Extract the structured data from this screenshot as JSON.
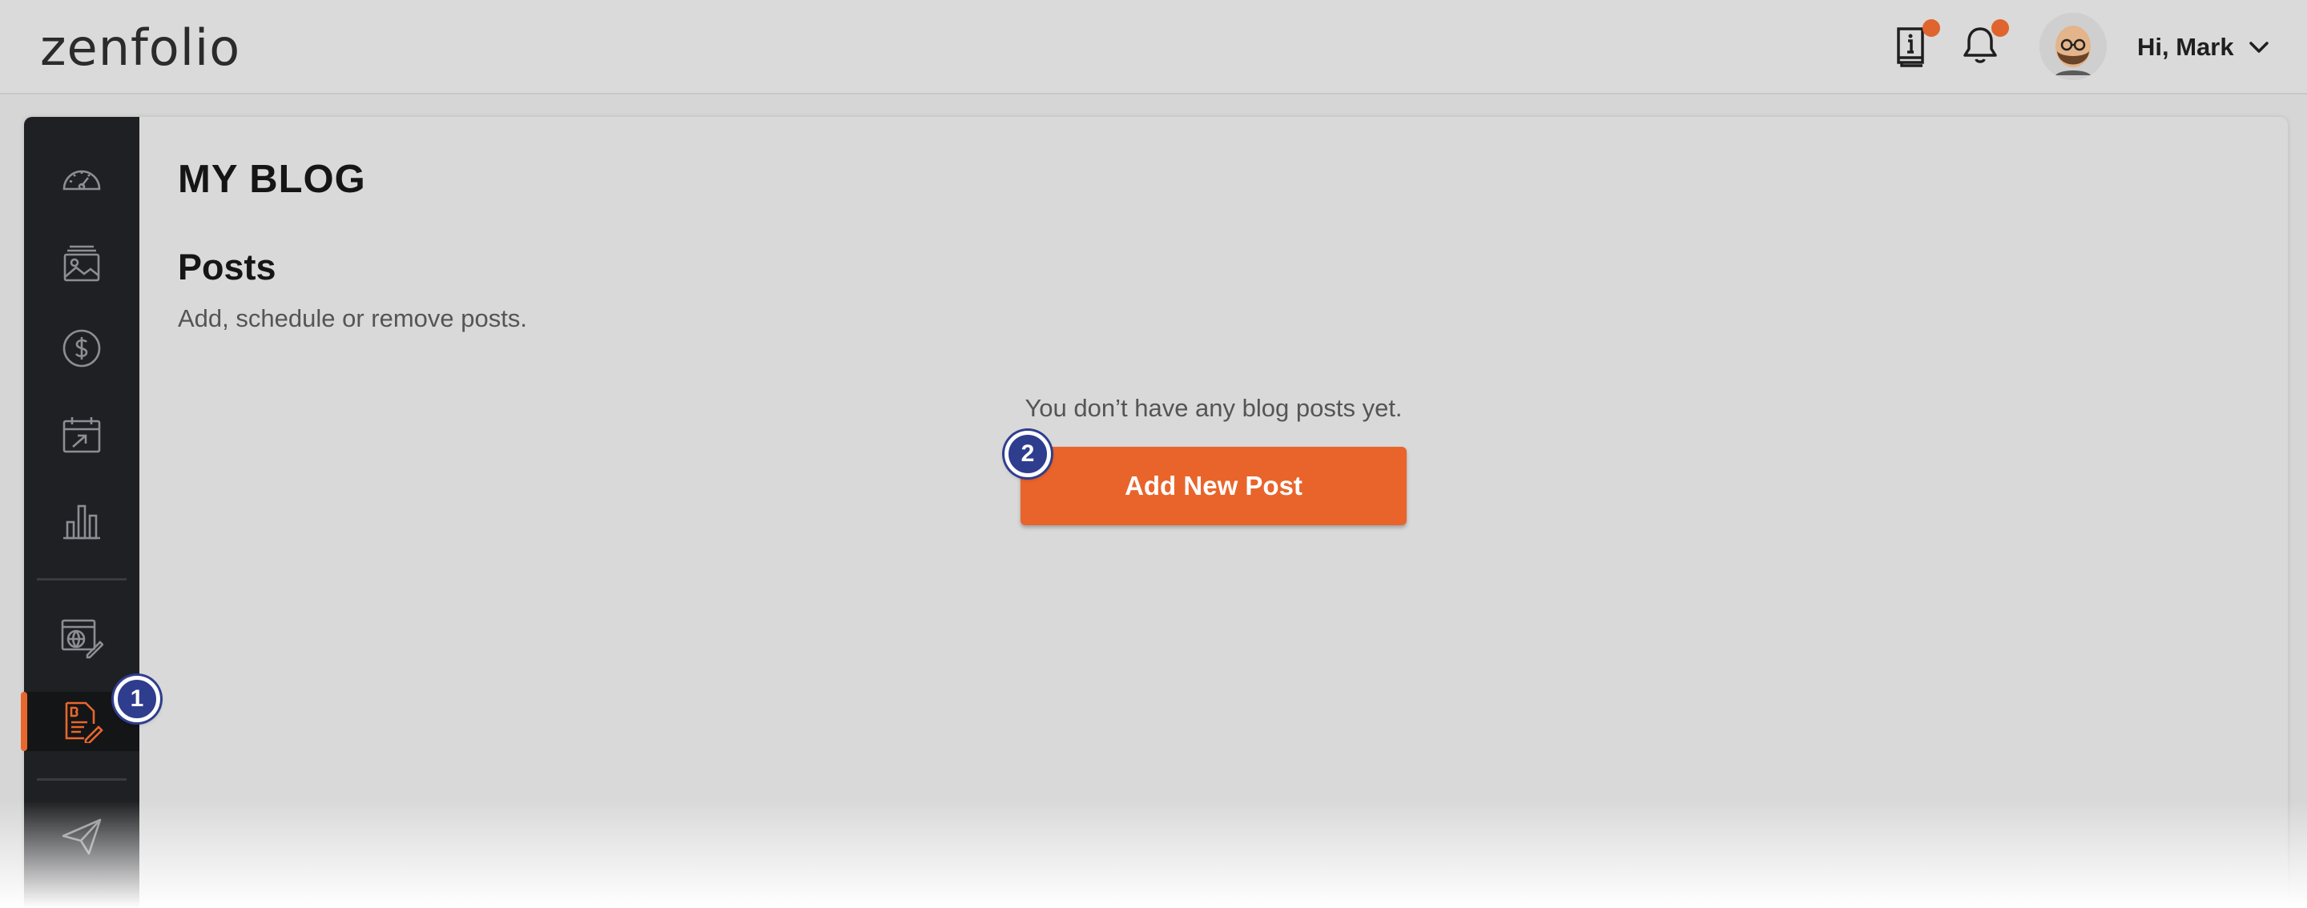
{
  "header": {
    "logo_text": "zenfolio",
    "greeting": "Hi, Mark",
    "icons": [
      "info-book-icon",
      "bell-icon",
      "chevron-down-icon"
    ],
    "notification_dot_color": "#e0642d"
  },
  "sidebar": {
    "items": [
      {
        "icon": "speedometer-icon",
        "active": false
      },
      {
        "icon": "gallery-icon",
        "active": false
      },
      {
        "icon": "dollar-icon",
        "active": false
      },
      {
        "icon": "calendar-icon",
        "active": false
      },
      {
        "icon": "bar-chart-icon",
        "active": false
      },
      {
        "icon": "website-edit-icon",
        "active": false
      },
      {
        "icon": "blog-edit-icon",
        "active": true
      },
      {
        "icon": "paper-plane-icon",
        "active": false
      }
    ],
    "accent_color": "#e8672d"
  },
  "main": {
    "title": "MY BLOG",
    "section_title": "Posts",
    "section_subtitle": "Add, schedule or remove posts.",
    "empty_message": "You don’t have any blog posts yet.",
    "add_button_label": "Add New Post"
  },
  "annotations": {
    "step1": "1",
    "step2": "2",
    "color": "#2f3d8e"
  }
}
